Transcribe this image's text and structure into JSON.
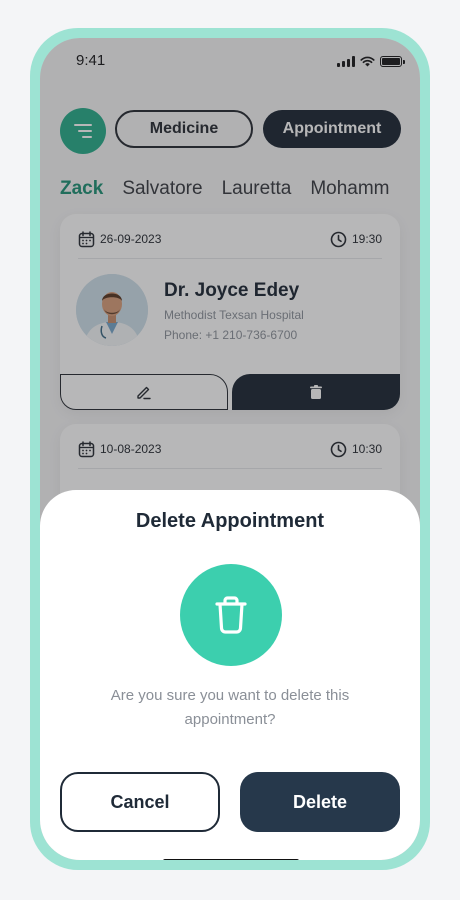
{
  "status_bar": {
    "time": "9:41"
  },
  "tabs": {
    "medicine": "Medicine",
    "appointment": "Appointment",
    "active": "Appointment"
  },
  "patients": [
    "Zack",
    "Salvatore",
    "Lauretta",
    "Mohamm"
  ],
  "active_patient": "Zack",
  "appointments": [
    {
      "date": "26-09-2023",
      "time": "19:30",
      "doctor": "Dr. Joyce Edey",
      "hospital": "Methodist Texsan Hospital",
      "phone": "Phone: +1 210-736-6700"
    },
    {
      "date": "10-08-2023",
      "time": "10:30"
    }
  ],
  "dialog": {
    "title": "Delete Appointment",
    "message": "Are you sure you want to delete this appointment?",
    "cancel_label": "Cancel",
    "delete_label": "Delete"
  },
  "colors": {
    "frame": "#9de3d3",
    "accent": "#2cae8d",
    "accent_light": "#3ccfae",
    "dark": "#1f2a37"
  },
  "icons": [
    "menu-icon",
    "calendar-icon",
    "clock-icon",
    "edit-icon",
    "trash-icon"
  ]
}
